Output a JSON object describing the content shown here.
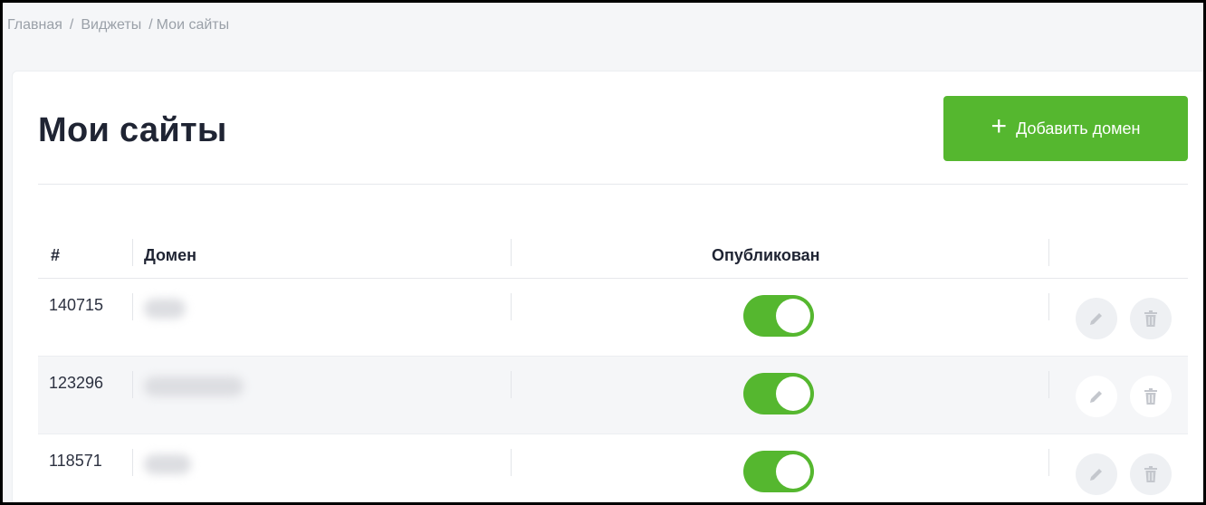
{
  "breadcrumb": {
    "items": [
      "Главная",
      "Виджеты",
      "Мои сайты"
    ],
    "separator": "/"
  },
  "page": {
    "title": "Мои сайты",
    "add_button_label": "Добавить домен",
    "add_button_icon": "plus-icon",
    "accent_color": "#55b72f"
  },
  "table": {
    "headers": {
      "index": "#",
      "domain": "Домен",
      "published": "Опубликован"
    },
    "rows": [
      {
        "id": "140715",
        "domain_blurred": true,
        "published": true
      },
      {
        "id": "123296",
        "domain_blurred": true,
        "published": true
      },
      {
        "id": "118571",
        "domain_blurred": true,
        "published": true
      }
    ],
    "row_actions": [
      "pencil-icon",
      "trash-icon"
    ]
  }
}
